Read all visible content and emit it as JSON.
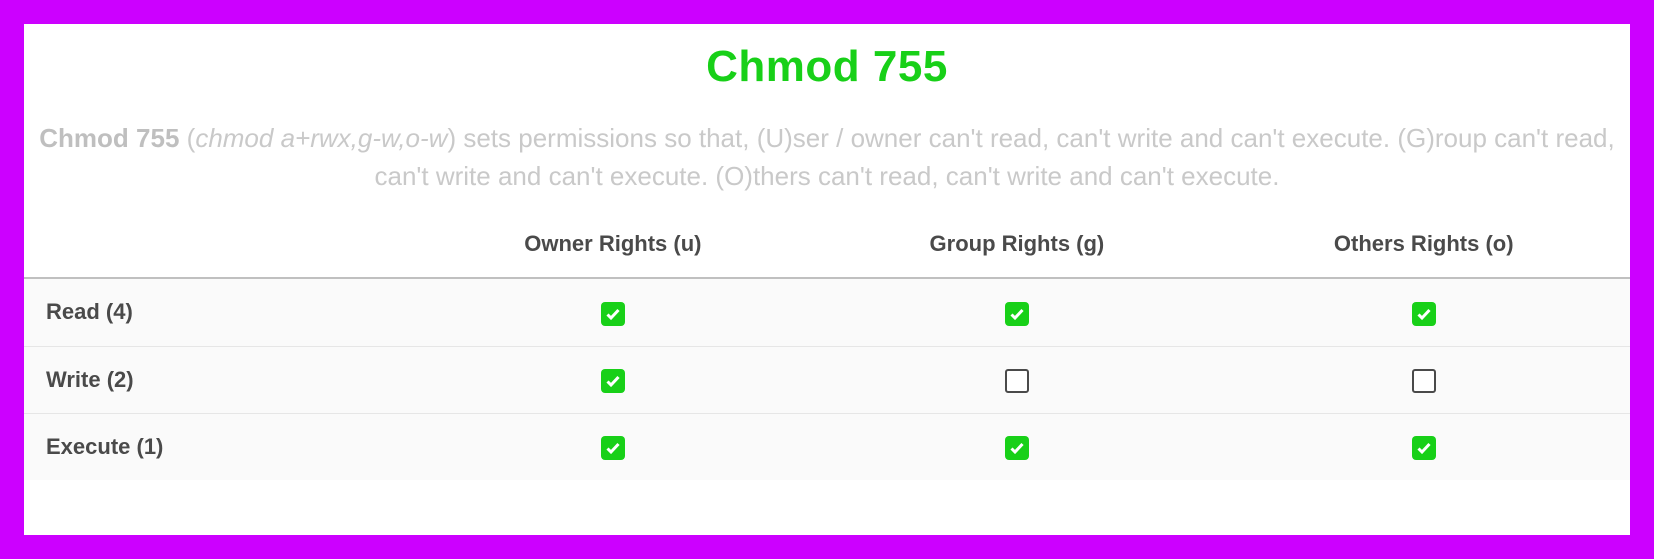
{
  "title": "Chmod 755",
  "description": {
    "bold_lead": "Chmod 755",
    "paren_open": " (",
    "italic": "chmod a+rwx,g-w,o-w",
    "rest": ") sets permissions so that, (U)ser / owner can't read, can't write and can't execute. (G)roup can't read, can't write and can't execute. (O)thers can't read, can't write and can't execute."
  },
  "columns": {
    "owner": "Owner Rights (u)",
    "group": "Group Rights (g)",
    "others": "Others Rights (o)"
  },
  "rows": [
    {
      "label": "Read (4)",
      "owner": true,
      "group": true,
      "others": true
    },
    {
      "label": "Write (2)",
      "owner": true,
      "group": false,
      "others": false
    },
    {
      "label": "Execute (1)",
      "owner": true,
      "group": true,
      "others": true
    }
  ]
}
